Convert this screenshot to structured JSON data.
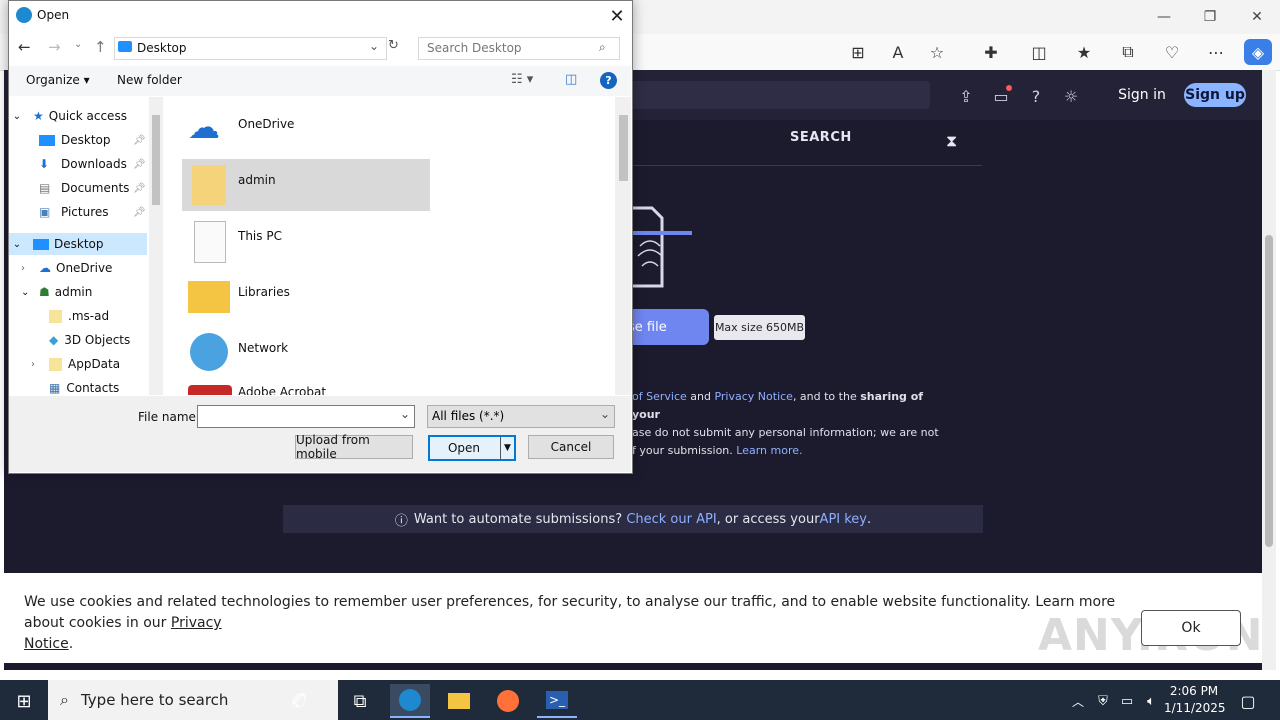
{
  "browser": {
    "window_controls": [
      "—",
      "❐",
      "✕"
    ],
    "toolbar_icons": [
      "apps-icon",
      "read-aloud-icon",
      "favorite-icon",
      "extensions-icon",
      "split-screen-icon",
      "favorites-icon",
      "collections-icon",
      "browser-essentials-icon",
      "more-icon",
      "copilot-icon"
    ]
  },
  "site": {
    "sign_in": "Sign in",
    "sign_up": "Sign up",
    "search_tab": "SEARCH",
    "choose_file": "se file",
    "max_size": "Max size 650MB",
    "terms_line1_a": "of Service",
    "terms_line1_b": " and ",
    "terms_line1_c": "Privacy Notice",
    "terms_line1_d": ", and to the ",
    "terms_line1_e": "sharing of your",
    "terms_line2": "ase do not submit any personal information; we are not",
    "terms_line3_a": "f your submission. ",
    "terms_line3_b": "Learn more.",
    "api_prefix": "Want to automate submissions? ",
    "api_link1": "Check our API",
    "api_mid": ", or access your ",
    "api_link2": "API key",
    "api_suffix": "."
  },
  "cookie": {
    "text": "We use cookies and related technologies to remember user preferences, for security, to analyse our traffic, and to enable website functionality. Learn more about cookies in our ",
    "link_a": "Privacy",
    "link_b": "Notice",
    "link_suffix": ".",
    "ok": "Ok",
    "watermark": "ANY.RUN"
  },
  "dialog": {
    "title": "Open",
    "address": "Desktop",
    "search_placeholder": "Search Desktop",
    "organize": "Organize",
    "new_folder": "New folder",
    "nav": [
      {
        "label": "Quick access",
        "icon": "star-icon"
      },
      {
        "label": "Desktop",
        "icon": "desktop-icon"
      },
      {
        "label": "Downloads",
        "icon": "download-icon"
      },
      {
        "label": "Documents",
        "icon": "document-icon"
      },
      {
        "label": "Pictures",
        "icon": "pictures-icon"
      },
      {
        "label": "Desktop",
        "icon": "desktop-icon"
      },
      {
        "label": "OneDrive",
        "icon": "cloud-icon"
      },
      {
        "label": "admin",
        "icon": "user-icon"
      },
      {
        "label": ".ms-ad",
        "icon": "folder-icon"
      },
      {
        "label": "3D Objects",
        "icon": "cube-icon"
      },
      {
        "label": "AppData",
        "icon": "folder-icon"
      },
      {
        "label": "Contacts",
        "icon": "contacts-icon"
      }
    ],
    "files": [
      {
        "label": "OneDrive"
      },
      {
        "label": "admin"
      },
      {
        "label": "This PC"
      },
      {
        "label": "Libraries"
      },
      {
        "label": "Network"
      },
      {
        "label": "Adobe Acrobat"
      }
    ],
    "file_name_label": "File name:",
    "file_name_value": "",
    "filter": "All files (*.*)",
    "upload_mobile": "Upload from mobile",
    "open": "Open",
    "cancel": "Cancel"
  },
  "taskbar": {
    "search_placeholder": "Type here to search",
    "time": "2:06 PM",
    "date": "1/11/2025"
  },
  "colors": {
    "page_bg": "#1c1b2e",
    "accent": "#8ab4ff",
    "selection": "#cce8ff"
  }
}
